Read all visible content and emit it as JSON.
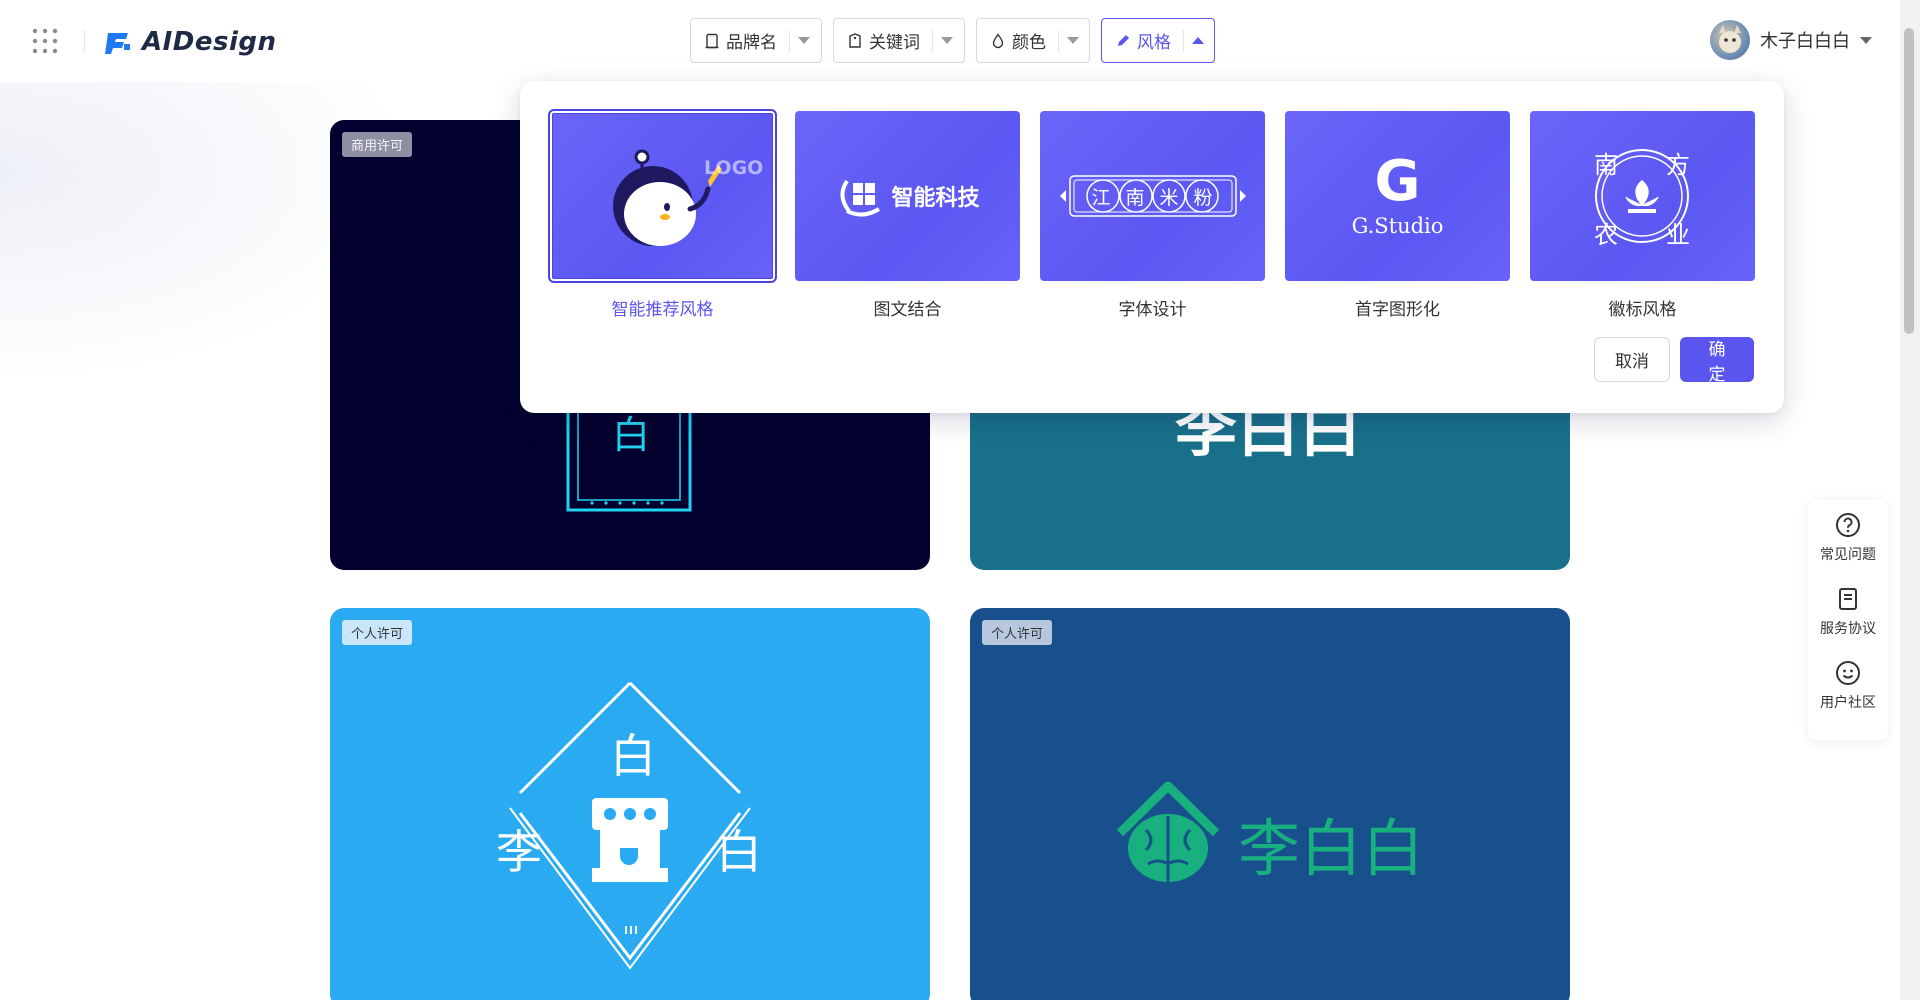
{
  "app": {
    "name": "AIDesign"
  },
  "filters": [
    {
      "label": "品牌名",
      "icon": "document-icon",
      "active": false
    },
    {
      "label": "关键词",
      "icon": "tag-icon",
      "active": false
    },
    {
      "label": "颜色",
      "icon": "droplet-icon",
      "active": false
    },
    {
      "label": "风格",
      "icon": "brush-icon",
      "active": true
    }
  ],
  "user": {
    "name": "木子白白白"
  },
  "style_panel": {
    "options": [
      {
        "label": "智能推荐风格",
        "thumb_text": "LOGO",
        "selected": true
      },
      {
        "label": "图文结合",
        "thumb_text": "智能科技",
        "selected": false
      },
      {
        "label": "字体设计",
        "thumb_text": "江南米粉",
        "selected": false
      },
      {
        "label": "首字图形化",
        "thumb_text": "G.Studio",
        "thumb_letter": "G",
        "selected": false
      },
      {
        "label": "徽标风格",
        "thumb_text": [
          "南",
          "方",
          "农",
          "业"
        ],
        "selected": false
      }
    ],
    "cancel_label": "取消",
    "confirm_label": "确定"
  },
  "cards": [
    {
      "badge": "商用许可",
      "text": "白",
      "bg": "#02002e"
    },
    {
      "badge": "",
      "text": "李白白",
      "bg": "#19708a"
    },
    {
      "badge": "个人许可",
      "text": [
        "白",
        "李",
        "白"
      ],
      "bg": "#2aaaf0"
    },
    {
      "badge": "个人许可",
      "text": "李白白",
      "bg": "#17508c"
    }
  ],
  "side_float": [
    {
      "label": "常见问题",
      "icon": "question-icon"
    },
    {
      "label": "服务协议",
      "icon": "document-icon"
    },
    {
      "label": "用户社区",
      "icon": "smile-icon"
    }
  ],
  "colors": {
    "accent": "#5b55f0",
    "thumb_bg": "#6360f6"
  }
}
